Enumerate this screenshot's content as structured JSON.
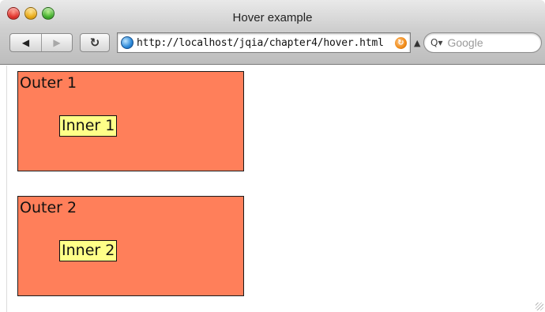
{
  "window": {
    "title": "Hover example",
    "buttons": [
      "close-icon",
      "minimize-icon",
      "zoom-icon"
    ]
  },
  "toolbar": {
    "back_glyph": "◀",
    "forward_glyph": "▶",
    "reload_glyph": "↻",
    "url": "http://localhost/jqia/chapter4/hover.html",
    "rss_glyph": "↻",
    "dropdown_glyph": "▲",
    "search_placeholder": "Google",
    "search_glyph": "Q▾"
  },
  "page": {
    "boxes": [
      {
        "outer_label": "Outer 1",
        "inner_label": "Inner 1"
      },
      {
        "outer_label": "Outer 2",
        "inner_label": "Inner 2"
      }
    ]
  },
  "colors": {
    "outer_fill": "#ff7f5a",
    "inner_fill": "#ffff88"
  }
}
